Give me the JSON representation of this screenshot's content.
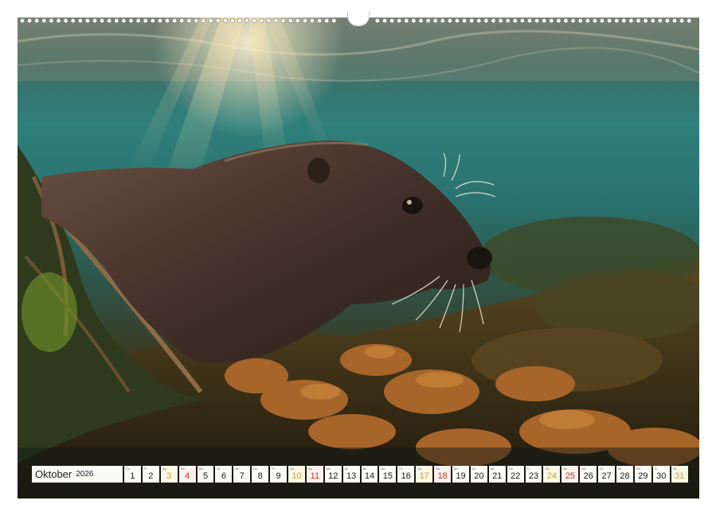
{
  "calendar": {
    "month": "Oktober",
    "year": "2026",
    "days": [
      {
        "wd": "Do",
        "n": "1",
        "t": "wk"
      },
      {
        "wd": "Fr",
        "n": "2",
        "t": "wk"
      },
      {
        "wd": "Sa",
        "n": "3",
        "t": "sat"
      },
      {
        "wd": "So",
        "n": "4",
        "t": "sun"
      },
      {
        "wd": "Mo",
        "n": "5",
        "t": "wk"
      },
      {
        "wd": "Di",
        "n": "6",
        "t": "wk"
      },
      {
        "wd": "Mi",
        "n": "7",
        "t": "wk"
      },
      {
        "wd": "Do",
        "n": "8",
        "t": "wk"
      },
      {
        "wd": "Fr",
        "n": "9",
        "t": "wk"
      },
      {
        "wd": "Sa",
        "n": "10",
        "t": "sat"
      },
      {
        "wd": "So",
        "n": "11",
        "t": "sun"
      },
      {
        "wd": "Mo",
        "n": "12",
        "t": "wk"
      },
      {
        "wd": "Di",
        "n": "13",
        "t": "wk"
      },
      {
        "wd": "Mi",
        "n": "14",
        "t": "wk"
      },
      {
        "wd": "Do",
        "n": "15",
        "t": "wk"
      },
      {
        "wd": "Fr",
        "n": "16",
        "t": "wk"
      },
      {
        "wd": "Sa",
        "n": "17",
        "t": "sat"
      },
      {
        "wd": "So",
        "n": "18",
        "t": "sun"
      },
      {
        "wd": "Mo",
        "n": "19",
        "t": "wk"
      },
      {
        "wd": "Di",
        "n": "20",
        "t": "wk"
      },
      {
        "wd": "Mi",
        "n": "21",
        "t": "wk"
      },
      {
        "wd": "Do",
        "n": "22",
        "t": "wk"
      },
      {
        "wd": "Fr",
        "n": "23",
        "t": "wk"
      },
      {
        "wd": "Sa",
        "n": "24",
        "t": "sat"
      },
      {
        "wd": "So",
        "n": "25",
        "t": "sun"
      },
      {
        "wd": "Mo",
        "n": "26",
        "t": "wk"
      },
      {
        "wd": "Di",
        "n": "27",
        "t": "wk"
      },
      {
        "wd": "Mi",
        "n": "28",
        "t": "wk"
      },
      {
        "wd": "Do",
        "n": "29",
        "t": "wk"
      },
      {
        "wd": "Fr",
        "n": "30",
        "t": "wk"
      },
      {
        "wd": "Sa",
        "n": "31",
        "t": "sat"
      }
    ]
  },
  "photo": {
    "subject": "otter-underwater-photo",
    "water_color": "#2f7f7b",
    "otter_color": "#4a3526",
    "seaweed_color": "#a8652a"
  }
}
